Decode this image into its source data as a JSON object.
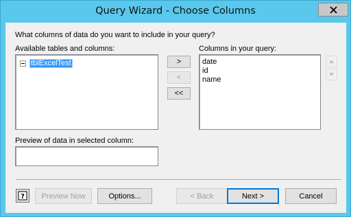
{
  "window": {
    "title": "Query Wizard - Choose Columns",
    "close_icon": "close-icon"
  },
  "dialog": {
    "prompt": "What columns of data do you want to include in your query?",
    "available_label": "Available tables and columns:",
    "available_tree": [
      {
        "label": "tblExcelTest",
        "expanded": true,
        "selected": true
      }
    ],
    "columns_label": "Columns in your query:",
    "query_columns": [
      "date",
      "id",
      "name"
    ],
    "preview_label": "Preview of data in selected column:",
    "preview_value": "",
    "move_buttons": {
      "add_one": ">",
      "remove_one": "<",
      "remove_all": "<<"
    }
  },
  "footer": {
    "help_icon": "help-icon",
    "preview_now": "Preview Now",
    "options": "Options...",
    "back": "< Back",
    "next": "Next >",
    "cancel": "Cancel"
  }
}
